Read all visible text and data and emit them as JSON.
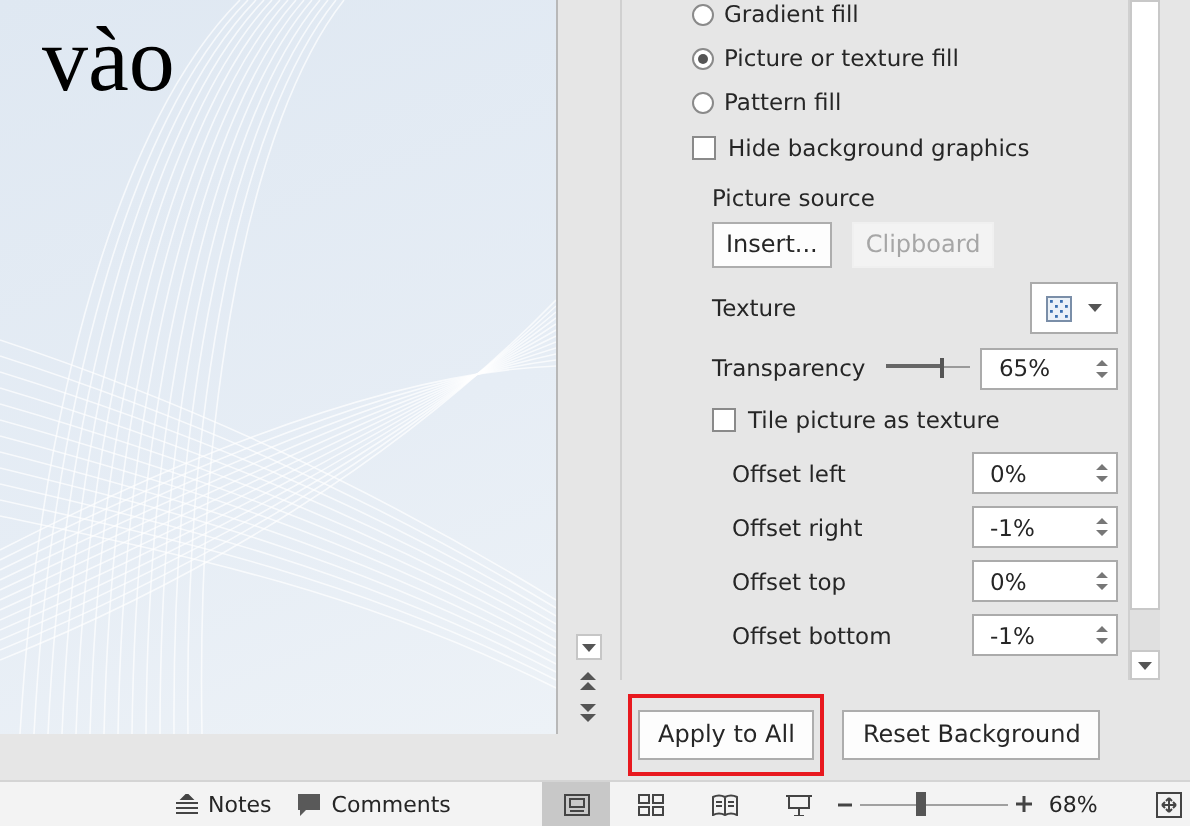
{
  "slide": {
    "title_fragment": "vào"
  },
  "format_pane": {
    "fill_options": [
      {
        "label": "Gradient fill",
        "selected": false
      },
      {
        "label": "Picture or texture fill",
        "selected": true
      },
      {
        "label": "Pattern fill",
        "selected": false
      }
    ],
    "hide_background_graphics": {
      "label": "Hide background graphics",
      "checked": false
    },
    "picture_source": {
      "label": "Picture source",
      "buttons": [
        {
          "label": "Insert...",
          "disabled": false
        },
        {
          "label": "Clipboard",
          "disabled": true
        }
      ]
    },
    "texture": {
      "label": "Texture"
    },
    "transparency": {
      "label": "Transparency",
      "level": 0.65,
      "value": "65%"
    },
    "tile_picture": {
      "label": "Tile picture as texture",
      "checked": false
    },
    "offsets": [
      {
        "label": "Offset left",
        "value": "0%"
      },
      {
        "label": "Offset right",
        "value": "-1%"
      },
      {
        "label": "Offset top",
        "value": "0%"
      },
      {
        "label": "Offset bottom",
        "value": "-1%"
      }
    ]
  },
  "actions": [
    {
      "label": "Apply to All",
      "highlighted": true
    },
    {
      "label": "Reset Background",
      "highlighted": false
    }
  ],
  "status_bar": {
    "notes": "Notes",
    "comments": "Comments",
    "views": [
      {
        "kind": "normal",
        "selected": true
      },
      {
        "kind": "sorter",
        "selected": false
      },
      {
        "kind": "reading",
        "selected": false
      },
      {
        "kind": "slideshow",
        "selected": false
      }
    ],
    "zoom": {
      "level": 0.4,
      "value": "68%"
    }
  }
}
